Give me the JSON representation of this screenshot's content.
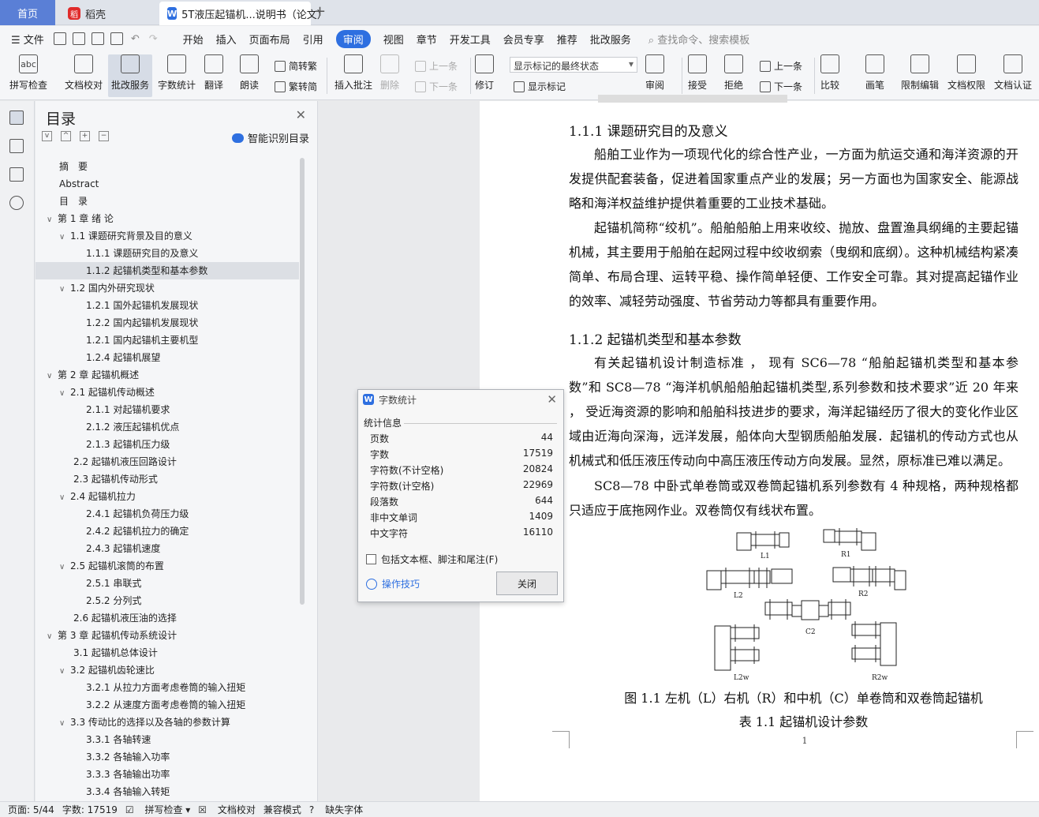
{
  "tabs": {
    "home": "首页",
    "daoke": "稻壳",
    "doc": "5T液压起锚机...说明书（论文）",
    "new_tab": "+"
  },
  "menu": {
    "file": "文件",
    "items": [
      "开始",
      "插入",
      "页面布局",
      "引用",
      "审阅",
      "视图",
      "章节",
      "开发工具",
      "会员专享",
      "推荐",
      "批改服务"
    ],
    "active": "审阅",
    "search": "查找命令、搜索模板"
  },
  "ribbon": {
    "spell": "拼写检查",
    "doc_check": "文档校对",
    "review_service": "批改服务",
    "word_count": "字数统计",
    "translate": "翻译",
    "read_aloud": "朗读",
    "to_trad": "简转繁",
    "to_simp": "繁转简",
    "insert_comment": "插入批注",
    "delete": "删除",
    "prev": "上一条",
    "next": "下一条",
    "revise": "修订",
    "markup_select": "显示标记的最终状态",
    "show_markup": "显示标记",
    "review": "审阅",
    "accept": "接受",
    "reject": "拒绝",
    "prev2": "上一条",
    "next2": "下一条",
    "compare": "比较",
    "pen": "画笔",
    "restrict": "限制编辑",
    "permission": "文档权限",
    "certify": "文档认证"
  },
  "nav": {
    "title": "目录",
    "smart": "智能识别目录",
    "items": [
      {
        "t": "摘　要",
        "lv": 0,
        "c": ""
      },
      {
        "t": "Abstract",
        "lv": 0,
        "c": ""
      },
      {
        "t": "目　录",
        "lv": 0,
        "c": ""
      },
      {
        "t": "第 1 章  绪  论",
        "lv": 0,
        "c": "v"
      },
      {
        "t": "1.1  课题研究背景及目的意义",
        "lv": 1,
        "c": "v"
      },
      {
        "t": "1.1.1  课题研究目的及意义",
        "lv": 2,
        "c": ""
      },
      {
        "t": "1.1.2  起锚机类型和基本参数",
        "lv": 2,
        "c": "",
        "sel": true
      },
      {
        "t": "1.2  国内外研究现状",
        "lv": 1,
        "c": "v"
      },
      {
        "t": "1.2.1  国外起锚机发展现状",
        "lv": 2,
        "c": ""
      },
      {
        "t": "1.2.2  国内起锚机发展现状",
        "lv": 2,
        "c": ""
      },
      {
        "t": "1.2.1  国内起锚机主要机型",
        "lv": 2,
        "c": ""
      },
      {
        "t": "1.2.4  起锚机展望",
        "lv": 2,
        "c": ""
      },
      {
        "t": "第 2 章  起锚机概述",
        "lv": 0,
        "c": "v"
      },
      {
        "t": "2.1  起锚机传动概述",
        "lv": 1,
        "c": "v"
      },
      {
        "t": "2.1.1  对起锚机要求",
        "lv": 2,
        "c": ""
      },
      {
        "t": "2.1.2  液压起锚机优点",
        "lv": 2,
        "c": ""
      },
      {
        "t": "2.1.3  起锚机压力级",
        "lv": 2,
        "c": ""
      },
      {
        "t": "2.2  起锚机液压回路设计",
        "lv": 1,
        "c": ""
      },
      {
        "t": "2.3  起锚机传动形式",
        "lv": 1,
        "c": ""
      },
      {
        "t": "2.4  起锚机拉力",
        "lv": 1,
        "c": "v"
      },
      {
        "t": "2.4.1  起锚机负荷压力级",
        "lv": 2,
        "c": ""
      },
      {
        "t": "2.4.2  起锚机拉力的确定",
        "lv": 2,
        "c": ""
      },
      {
        "t": "2.4.3  起锚机速度",
        "lv": 2,
        "c": ""
      },
      {
        "t": "2.5  起锚机滚筒的布置",
        "lv": 1,
        "c": "v"
      },
      {
        "t": "2.5.1  串联式",
        "lv": 2,
        "c": ""
      },
      {
        "t": "2.5.2  分列式",
        "lv": 2,
        "c": ""
      },
      {
        "t": "2.6  起锚机液压油的选择",
        "lv": 1,
        "c": ""
      },
      {
        "t": "第 3 章  起锚机传动系统设计",
        "lv": 0,
        "c": "v"
      },
      {
        "t": "3.1  起锚机总体设计",
        "lv": 1,
        "c": ""
      },
      {
        "t": "3.2  起锚机齿轮速比",
        "lv": 1,
        "c": "v"
      },
      {
        "t": "3.2.1  从拉力方面考虑卷筒的输入扭矩",
        "lv": 2,
        "c": ""
      },
      {
        "t": "3.2.2  从速度方面考虑卷筒的输入扭矩",
        "lv": 2,
        "c": ""
      },
      {
        "t": "3.3  传动比的选择以及各轴的参数计算",
        "lv": 1,
        "c": "v"
      },
      {
        "t": "3.3.1  各轴转速",
        "lv": 2,
        "c": ""
      },
      {
        "t": "3.3.2  各轴输入功率",
        "lv": 2,
        "c": ""
      },
      {
        "t": "3.3.3  各轴输出功率",
        "lv": 2,
        "c": ""
      },
      {
        "t": "3.3.4  各轴输入转矩",
        "lv": 2,
        "c": ""
      }
    ]
  },
  "doc": {
    "h1": "1.1.1  课题研究目的及意义",
    "p1": "船舶工业作为一项现代化的综合性产业，一方面为航运交通和海洋资源的开发提供配套装备，促进着国家重点产业的发展；另一方面也为国家安全、能源战略和海洋权益维护提供着重要的工业技术基础。",
    "p2": "起锚机简称“绞机”。船舶船舶上用来收绞、抛放、盘置渔具纲绳的主要起锚机械，其主要用于船舶在起网过程中绞收纲索（曳纲和底纲）。这种机械结构紧凑简单、布局合理、运转平稳、操作简单轻便、工作安全可靠。其对提高起锚作业的效率、减轻劳动强度、节省劳动力等都具有重要作用。",
    "h2": "1.1.2  起锚机类型和基本参数",
    "p3": "有关起锚机设计制造标准 ， 现有  SC6—78 “船舶起锚机类型和基本参数”和 SC8—78 “海洋机帆船船舶起锚机类型,系列参数和技术要求”近 20 年来 ， 受近海资源的影响和船舶科技进步的要求，海洋起锚经历了很大的变化作业区域由近海向深海，远洋发展，船体向大型钢质船舶发展．起锚机的传动方式也从机械式和低压液压传动向中高压液压传动方向发展。显然，原标准已难以满足。",
    "p4": "SC8—78 中卧式单卷筒或双卷筒起锚机系列参数有 4 种规格，两种规格都只适应于底拖网作业。双卷筒仅有线状布置。",
    "fig_labels": [
      "L1",
      "R1",
      "L2",
      "R2",
      "C2",
      "L2w",
      "R2w"
    ],
    "caption": "图 1.1  左机（L）右机（R）和中机（C）单卷筒和双卷筒起锚机",
    "table_title": "表 1.1  起锚机设计参数",
    "page_number": "1"
  },
  "dialog": {
    "title": "字数统计",
    "section": "统计信息",
    "rows": [
      {
        "label": "页数",
        "value": "44"
      },
      {
        "label": "字数",
        "value": "17519"
      },
      {
        "label": "字符数(不计空格)",
        "value": "20824"
      },
      {
        "label": "字符数(计空格)",
        "value": "22969"
      },
      {
        "label": "段落数",
        "value": "644"
      },
      {
        "label": "非中文单词",
        "value": "1409"
      },
      {
        "label": "中文字符",
        "value": "16110"
      }
    ],
    "checkbox": "包括文本框、脚注和尾注(F)",
    "tips": "操作技巧",
    "close": "关闭"
  },
  "status": {
    "page": "页面: 5/44",
    "words": "字数: 17519",
    "spell": "拼写检查",
    "check": "文档校对",
    "compat": "兼容模式",
    "font": "缺失字体"
  }
}
